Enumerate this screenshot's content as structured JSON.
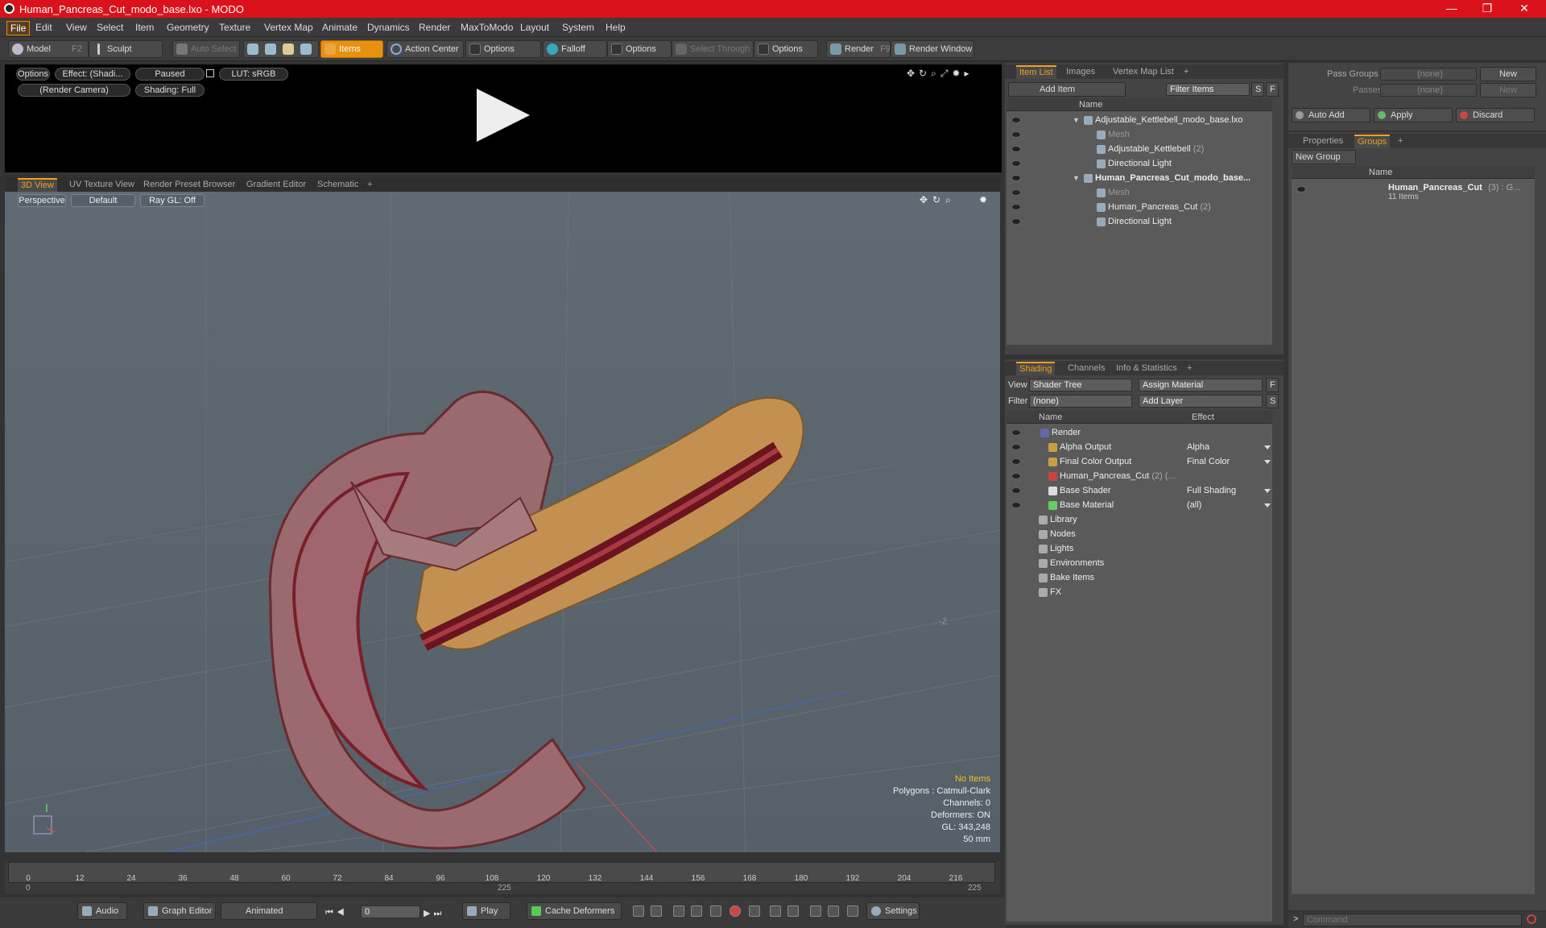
{
  "window": {
    "title": "Human_Pancreas_Cut_modo_base.lxo - MODO",
    "minimize": "—",
    "maximize": "❐",
    "close": "✕"
  },
  "menu": [
    "File",
    "Edit",
    "View",
    "Select",
    "Item",
    "Geometry",
    "Texture",
    "Vertex Map",
    "Animate",
    "Dynamics",
    "Render",
    "MaxToModo",
    "Layout",
    "System",
    "Help"
  ],
  "toolbar": {
    "model": "Model",
    "model_key": "F2",
    "sculpt": "Sculpt",
    "auto_select": "Auto Select",
    "items": "Items",
    "action_center": "Action Center",
    "options1": "Options",
    "falloff": "Falloff",
    "options2": "Options",
    "select_through": "Select Through",
    "options3": "Options",
    "render": "Render",
    "render_key": "F9",
    "render_window": "Render Window"
  },
  "preview": {
    "options": "Options",
    "effect": "Effect: (Shadi...",
    "paused": "Paused",
    "lut": "LUT: sRGB",
    "camera": "(Render Camera)",
    "shading": "Shading: Full"
  },
  "viewport_tabs": [
    "3D View",
    "UV Texture View",
    "Render Preset Browser",
    "Gradient Editor",
    "Schematic",
    "+"
  ],
  "viewport": {
    "perspective": "Perspective",
    "default": "Default",
    "raygl": "Ray GL: Off",
    "axis_label": "-Z"
  },
  "stats": {
    "no_items": "No Items",
    "polygons": "Polygons : Catmull-Clark",
    "channels": "Channels: 0",
    "deformers": "Deformers: ON",
    "gl": "GL: 343,248",
    "mm": "50 mm"
  },
  "timeline": {
    "ticks": [
      "0",
      "12",
      "24",
      "36",
      "48",
      "60",
      "72",
      "84",
      "96",
      "108",
      "120",
      "132",
      "144",
      "156",
      "168",
      "180",
      "192",
      "204",
      "216"
    ],
    "start": "0",
    "mid": "225",
    "end": "225"
  },
  "bottom": {
    "audio": "Audio",
    "graph_editor": "Graph Editor",
    "animated": "Animated",
    "frame": "0",
    "play": "Play",
    "cache": "Cache Deformers",
    "settings": "Settings"
  },
  "itemlist": {
    "tabs": [
      "Item List",
      "Images",
      "Vertex Map List",
      "+"
    ],
    "add_item": "Add Item",
    "filter": "Filter Items",
    "s": "S",
    "f": "F",
    "col_name": "Name",
    "rows": [
      {
        "label": "Adjustable_Kettlebell_modo_base.lxo",
        "count": "",
        "level": 0,
        "bold": false
      },
      {
        "label": "Mesh",
        "count": "",
        "level": 1,
        "bold": false,
        "dim": true
      },
      {
        "label": "Adjustable_Kettlebell",
        "count": "(2)",
        "level": 1,
        "bold": false
      },
      {
        "label": "Directional Light",
        "count": "",
        "level": 1,
        "bold": false
      },
      {
        "label": "Human_Pancreas_Cut_modo_base...",
        "count": "",
        "level": 0,
        "bold": true
      },
      {
        "label": "Mesh",
        "count": "",
        "level": 1,
        "bold": false,
        "dim": true
      },
      {
        "label": "Human_Pancreas_Cut",
        "count": "(2)",
        "level": 1,
        "bold": false
      },
      {
        "label": "Directional Light",
        "count": "",
        "level": 1,
        "bold": false
      }
    ]
  },
  "shading": {
    "tabs": [
      "Shading",
      "Channels",
      "Info & Statistics",
      "+"
    ],
    "view_label": "View",
    "view": "Shader Tree",
    "assign": "Assign Material",
    "filter_label": "Filter",
    "filter": "(none)",
    "add_layer": "Add Layer",
    "f": "F",
    "s": "S",
    "col_name": "Name",
    "col_effect": "Effect",
    "rows": [
      {
        "label": "Render",
        "effect": "",
        "count": ""
      },
      {
        "label": "Alpha Output",
        "effect": "Alpha",
        "count": ""
      },
      {
        "label": "Final Color Output",
        "effect": "Final Color",
        "count": ""
      },
      {
        "label": "Human_Pancreas_Cut",
        "effect": "",
        "count": "(2) (..."
      },
      {
        "label": "Base Shader",
        "effect": "Full Shading",
        "count": ""
      },
      {
        "label": "Base Material",
        "effect": "(all)",
        "count": ""
      },
      {
        "label": "Library",
        "effect": "",
        "count": ""
      },
      {
        "label": "Nodes",
        "effect": "",
        "count": ""
      },
      {
        "label": "Lights",
        "effect": "",
        "count": ""
      },
      {
        "label": "Environments",
        "effect": "",
        "count": ""
      },
      {
        "label": "Bake Items",
        "effect": "",
        "count": ""
      },
      {
        "label": "FX",
        "effect": "",
        "count": ""
      }
    ]
  },
  "passes": {
    "pass_groups": "Pass Groups",
    "passes": "Passes",
    "none": "(none)",
    "new": "New",
    "auto_add": "Auto Add",
    "apply": "Apply",
    "discard": "Discard"
  },
  "groups": {
    "tabs": [
      "Properties",
      "Groups",
      "+"
    ],
    "new_group": "New Group",
    "col_name": "Name",
    "group": "Human_Pancreas_Cut",
    "group_count": "(3) : G...",
    "items": "11 Items"
  },
  "command": {
    "placeholder": "Command",
    "prompt": ">"
  }
}
